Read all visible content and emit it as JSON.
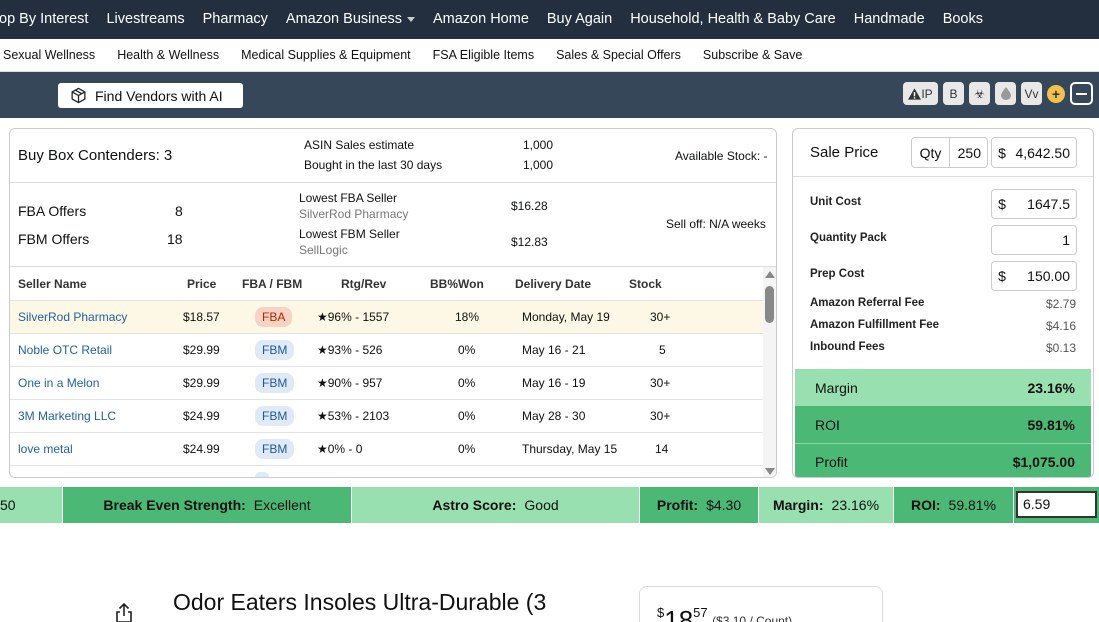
{
  "topnav": {
    "items": [
      "op By Interest",
      "Livestreams",
      "Pharmacy",
      "Amazon Business",
      "Amazon Home",
      "Buy Again",
      "Household, Health & Baby Care",
      "Handmade",
      "Books"
    ]
  },
  "subnav": {
    "items": [
      "Sexual Wellness",
      "Health & Wellness",
      "Medical Supplies & Equipment",
      "FSA Eligible Items",
      "Sales & Special Offers",
      "Subscribe & Save"
    ]
  },
  "extbar": {
    "vendor_button": "Find Vendors with AI",
    "icons": {
      "ip": "IP",
      "b": "B",
      "vv": "Vv"
    }
  },
  "summary": {
    "buy_box": "Buy Box Contenders: 3",
    "asin_sales_label": "ASIN Sales estimate",
    "asin_sales_value": "1,000",
    "bought_label": "Bought in the last 30 days",
    "bought_value": "1,000",
    "available_stock": "Available Stock: -",
    "fba_offers_label": "FBA Offers",
    "fba_offers_value": "8",
    "fbm_offers_label": "FBM Offers",
    "fbm_offers_value": "18",
    "lowest_fba_label": "Lowest FBA Seller",
    "lowest_fba_name": "SilverRod Pharmacy",
    "lowest_fba_price": "$16.28",
    "lowest_fbm_label": "Lowest FBM Seller",
    "lowest_fbm_name": "SellLogic",
    "lowest_fbm_price": "$12.83",
    "sell_off": "Sell off: N/A weeks"
  },
  "table": {
    "headers": [
      "Seller Name",
      "Price",
      "FBA / FBM",
      "Rtg/Rev",
      "BB%Won",
      "Delivery Date",
      "Stock"
    ],
    "rows": [
      {
        "seller": "SilverRod Pharmacy",
        "price": "$18.57",
        "type": "FBA",
        "rating": "★96% - 1557",
        "bb": "18%",
        "delivery": "Monday, May 19",
        "stock": "30+"
      },
      {
        "seller": "Noble OTC Retail",
        "price": "$29.99",
        "type": "FBM",
        "rating": "★93% - 526",
        "bb": "0%",
        "delivery": "May 16 - 21",
        "stock": "5"
      },
      {
        "seller": "One in a Melon",
        "price": "$29.99",
        "type": "FBM",
        "rating": "★90% - 957",
        "bb": "0%",
        "delivery": "May 16 - 19",
        "stock": "30+"
      },
      {
        "seller": "3M Marketing LLC",
        "price": "$24.99",
        "type": "FBM",
        "rating": "★53% - 2103",
        "bb": "0%",
        "delivery": "May 28 - 30",
        "stock": "30+"
      },
      {
        "seller": "love metal",
        "price": "$24.99",
        "type": "FBM",
        "rating": "★0% - 0",
        "bb": "0%",
        "delivery": "Thursday, May 15",
        "stock": "14"
      }
    ]
  },
  "calc": {
    "sale_price_label": "Sale Price",
    "qty_label": "Qty",
    "qty_value": "250",
    "sale_currency": "$",
    "sale_value": "4,642.50",
    "unit_cost_label": "Unit Cost",
    "unit_cost_value": "1647.5",
    "quantity_pack_label": "Quantity Pack",
    "quantity_pack_value": "1",
    "prep_cost_label": "Prep Cost",
    "prep_cost_value": "150.00",
    "currency": "$",
    "referral_label": "Amazon Referral Fee",
    "referral_value": "$2.79",
    "fulfillment_label": "Amazon Fulfillment Fee",
    "fulfillment_value": "$4.16",
    "inbound_label": "Inbound Fees",
    "inbound_value": "$0.13",
    "margin_label": "Margin",
    "margin_value": "23.16%",
    "roi_label": "ROI",
    "roi_value": "59.81%",
    "profit_label": "Profit",
    "profit_value": "$1,075.00"
  },
  "strength": {
    "left_value": "50",
    "break_even_label": "Break Even Strength:",
    "break_even_value": "Excellent",
    "astro_label": "Astro Score:",
    "astro_value": "Good",
    "profit_label": "Profit:",
    "profit_value": "$4.30",
    "margin_label": "Margin:",
    "margin_value": "23.16%",
    "roi_label": "ROI:",
    "roi_value": "59.81%",
    "input_value": "6.59"
  },
  "product": {
    "title": "Odor Eaters Insoles Ultra-Durable (3",
    "price_symbol": "$",
    "price_dollars": "18",
    "price_cents": "57",
    "unit_price": "($3.10 / Count)"
  },
  "colors": {
    "nav_bg": "#232f3e",
    "ext_bg": "#37475a",
    "green_light": "#99e0b0",
    "green_dark": "#4cb876",
    "link": "#2162a1"
  }
}
